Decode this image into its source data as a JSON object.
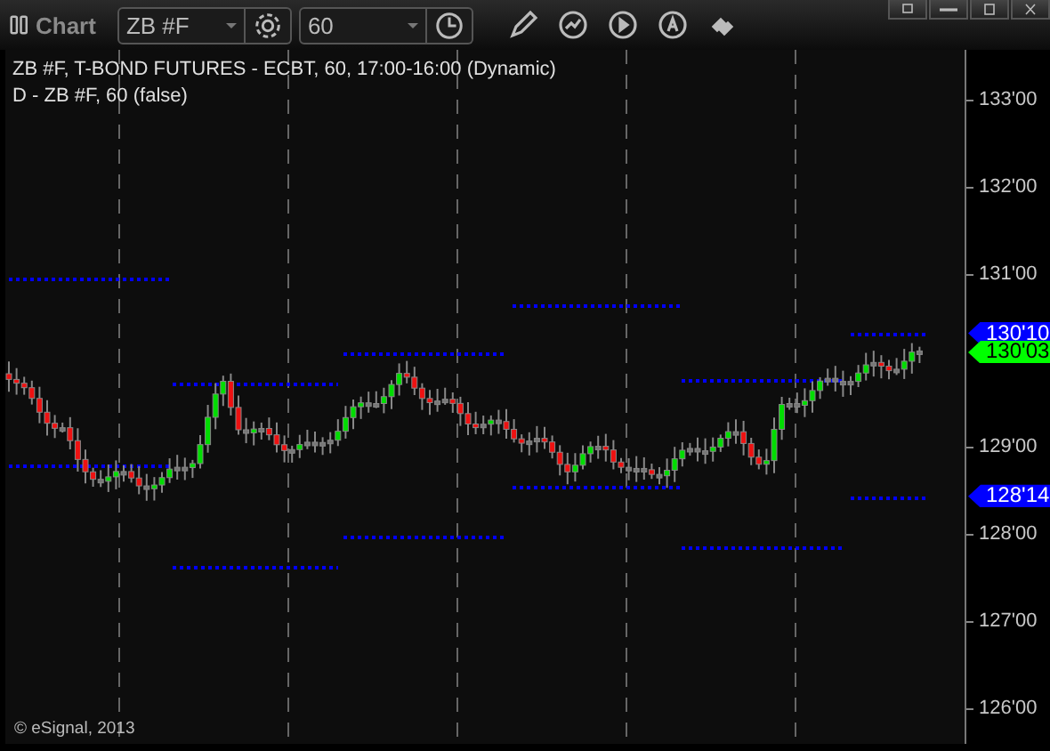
{
  "toolbar": {
    "title": "Chart",
    "symbol": "ZB #F",
    "interval": "60"
  },
  "chart": {
    "legend": [
      "ZB #F, T-BOND FUTURES - ECBT, 60, 17:00-16:00 (Dynamic)",
      "D - ZB #F, 60 (false)"
    ],
    "copyright": "© eSignal, 2013",
    "price_axis": [
      "133'00",
      "132'00",
      "131'00",
      "129'00",
      "128'00",
      "127'00",
      "126'00"
    ],
    "price_flags": [
      {
        "label": "130'10",
        "color": "#0000ff"
      },
      {
        "label": "130'03",
        "color": "#00ff00"
      },
      {
        "label": "128'14",
        "color": "#0000ff"
      }
    ]
  }
}
